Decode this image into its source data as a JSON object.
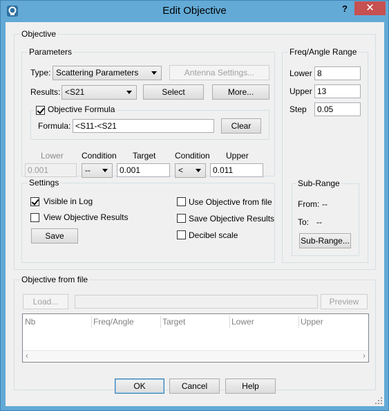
{
  "window": {
    "title": "Edit Objective",
    "help": "?",
    "close": "✕"
  },
  "objective": {
    "legend": "Objective",
    "parameters": {
      "legend": "Parameters",
      "type_label": "Type:",
      "type_value": "Scattering Parameters",
      "antenna_settings": "Antenna Settings...",
      "results_label": "Results:",
      "results_value": "<S21",
      "select": "Select",
      "more": "More...",
      "formula_checkbox": "Objective Formula",
      "formula_checked": true,
      "formula_label": "Formula:",
      "formula_value": "<S11-<S21",
      "clear": "Clear",
      "headers": {
        "lower": "Lower",
        "condition1": "Condition",
        "target": "Target",
        "condition2": "Condition",
        "upper": "Upper"
      },
      "values": {
        "lower": "0.001",
        "condition1": "--",
        "target": "0.001",
        "condition2": "<",
        "upper": "0.011"
      }
    },
    "settings": {
      "legend": "Settings",
      "visible_in_log": "Visible in Log",
      "visible_in_log_checked": true,
      "view_results": "View Objective Results",
      "save": "Save",
      "use_from_file": "Use Objective from file",
      "save_results": "Save Objective Results",
      "decibel": "Decibel scale"
    },
    "freq": {
      "legend": "Freq/Angle Range",
      "lower_label": "Lower",
      "lower_value": "8",
      "upper_label": "Upper",
      "upper_value": "13",
      "step_label": "Step",
      "step_value": "0.05",
      "subrange": {
        "legend": "Sub-Range",
        "from_label": "From:",
        "from_value": "--",
        "to_label": "To:",
        "to_value": "--",
        "button": "Sub-Range..."
      }
    }
  },
  "from_file": {
    "legend": "Objective from file",
    "load": "Load...",
    "path": "",
    "preview": "Preview",
    "columns": [
      "Nb",
      "Freq/Angle",
      "Target",
      "Lower",
      "Upper"
    ]
  },
  "footer": {
    "ok": "OK",
    "cancel": "Cancel",
    "help": "Help"
  },
  "colors": {
    "titlebar": "#63aad6",
    "close": "#c75050",
    "client": "#f0f0f0"
  }
}
